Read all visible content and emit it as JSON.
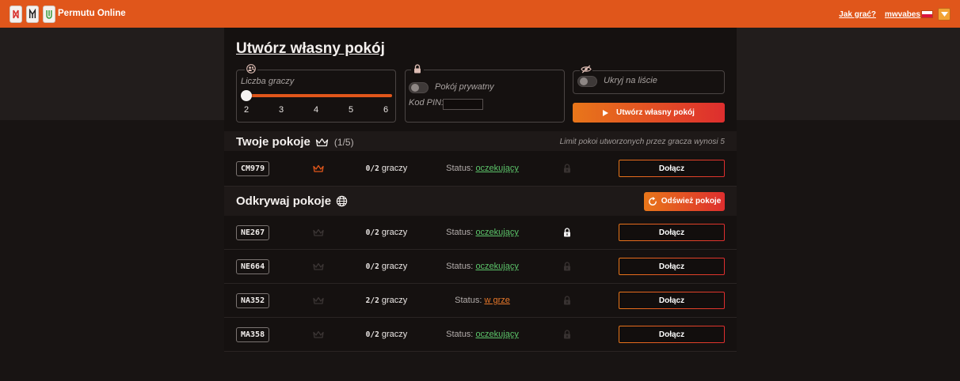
{
  "header": {
    "app_title": "Permutu Online",
    "logo_tiles": [
      {
        "icon": "tile-red-glyph-icon",
        "color": "#d8322e"
      },
      {
        "icon": "tile-dark-glyph-icon",
        "color": "#222222"
      },
      {
        "icon": "tile-green-glyph-icon",
        "color": "#3a9a3a"
      }
    ],
    "help_link": "Jak grać?",
    "username": "mwvabes",
    "language_flag": "flag-pl-icon",
    "menu_toggle_icon": "triangle-down-icon"
  },
  "create_room": {
    "title": "Utwórz własny pokój",
    "players": {
      "icon": "users-icon",
      "label": "Liczba graczy",
      "min": 2,
      "max": 6,
      "value": 2,
      "ticks": [
        "2",
        "3",
        "4",
        "5",
        "6"
      ]
    },
    "private_room": {
      "icon": "lock-icon",
      "label": "Pokój prywatny",
      "enabled": false,
      "pin_label": "Kod PIN:",
      "pin_value": ""
    },
    "hide_from_list": {
      "icon": "eye-slash-icon",
      "label": "Ukryj na liście",
      "enabled": false
    },
    "submit": {
      "icon": "play-icon",
      "label": "Utwórz własny pokój"
    }
  },
  "my_rooms": {
    "title": "Twoje pokoje",
    "icon": "crown-icon",
    "count": "(1/5)",
    "limit_note": "Limit pokoi utworzonych przez gracza wynosi 5",
    "rooms": [
      {
        "code": "CM979",
        "owner": true,
        "players": "0/2",
        "players_label": "graczy",
        "status_label": "Status:",
        "status": "oczekujący",
        "status_color": "#5cc46a",
        "locked": false,
        "join_label": "Dołącz"
      }
    ]
  },
  "discover_rooms": {
    "title": "Odkrywaj pokoje",
    "icon": "globe-icon",
    "refresh": {
      "icon": "refresh-icon",
      "label": "Odśwież pokoje"
    },
    "rooms": [
      {
        "code": "NE267",
        "owner": false,
        "players": "0/2",
        "players_label": "graczy",
        "status_label": "Status:",
        "status": "oczekujący",
        "status_color": "#5cc46a",
        "locked": true,
        "join_label": "Dołącz"
      },
      {
        "code": "NE664",
        "owner": false,
        "players": "0/2",
        "players_label": "graczy",
        "status_label": "Status:",
        "status": "oczekujący",
        "status_color": "#5cc46a",
        "locked": false,
        "join_label": "Dołącz"
      },
      {
        "code": "NA352",
        "owner": false,
        "players": "2/2",
        "players_label": "graczy",
        "status_label": "Status:",
        "status": "w grze",
        "status_color": "#e8782a",
        "locked": false,
        "join_label": "Dołącz"
      },
      {
        "code": "MA358",
        "owner": false,
        "players": "0/2",
        "players_label": "graczy",
        "status_label": "Status:",
        "status": "oczekujący",
        "status_color": "#5cc46a",
        "locked": false,
        "join_label": "Dołącz"
      }
    ]
  },
  "theme": {
    "accent": "#e0561b",
    "gradient_start": "#e8761a",
    "gradient_end": "#de2e2e"
  }
}
